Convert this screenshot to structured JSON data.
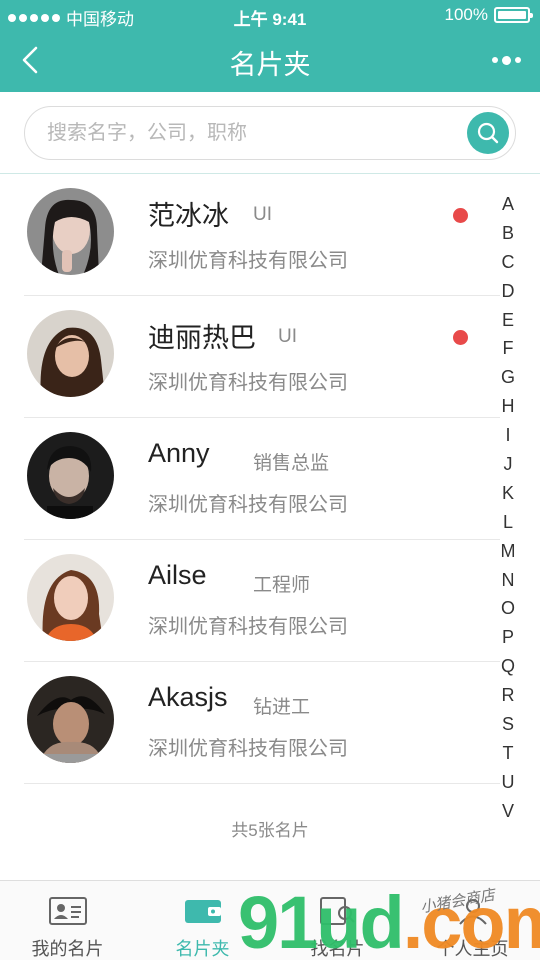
{
  "status_bar": {
    "carrier": "中国移动",
    "time": "上午 9:41",
    "battery": "100%"
  },
  "navbar": {
    "title": "名片夹",
    "back_icon": "chevron-left-icon",
    "more_icon": "more-dots-icon"
  },
  "search": {
    "placeholder": "搜索名字，公司，职称",
    "value": "",
    "icon": "search-icon"
  },
  "contacts": [
    {
      "name": "范冰冰",
      "role": "UI",
      "company": "深圳优育科技有限公司",
      "unread": true
    },
    {
      "name": "迪丽热巴",
      "role": "UI",
      "company": "深圳优育科技有限公司",
      "unread": true
    },
    {
      "name": "Anny",
      "role": "销售总监",
      "company": "深圳优育科技有限公司",
      "unread": false
    },
    {
      "name": "Ailse",
      "role": "工程师",
      "company": "深圳优育科技有限公司",
      "unread": false
    },
    {
      "name": "Akasjs",
      "role": "钻进工",
      "company": "深圳优育科技有限公司",
      "unread": false
    }
  ],
  "summary": "共5张名片",
  "index_letters": [
    "A",
    "B",
    "C",
    "D",
    "E",
    "F",
    "G",
    "H",
    "I",
    "J",
    "K",
    "L",
    "M",
    "N",
    "O",
    "P",
    "Q",
    "R",
    "S",
    "T",
    "U",
    "V"
  ],
  "tabs": [
    {
      "label": "我的名片",
      "icon": "id-card-icon",
      "active": false
    },
    {
      "label": "名片夹",
      "icon": "wallet-icon",
      "active": true
    },
    {
      "label": "找名片",
      "icon": "find-card-icon",
      "active": false
    },
    {
      "label": "个人主页",
      "icon": "person-icon",
      "active": false
    }
  ],
  "watermark": {
    "main": "91ud",
    "tld": ".com",
    "sub": "小猪会商店"
  },
  "colors": {
    "accent": "#3eb9ad",
    "unread_dot": "#e84a4a",
    "text_secondary": "#8a8a8a"
  }
}
